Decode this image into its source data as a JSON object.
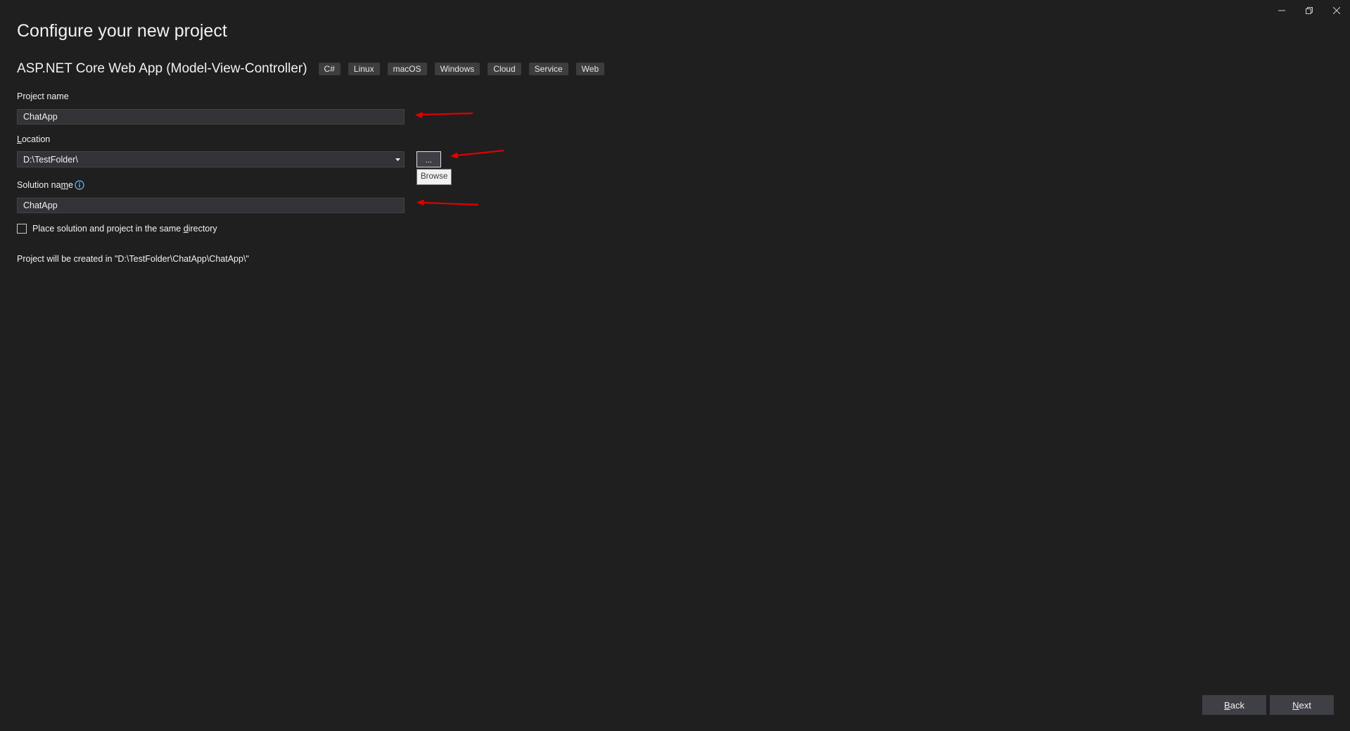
{
  "page": {
    "title": "Configure your new project"
  },
  "template": {
    "name": "ASP.NET Core Web App (Model-View-Controller)",
    "tags": [
      "C#",
      "Linux",
      "macOS",
      "Windows",
      "Cloud",
      "Service",
      "Web"
    ]
  },
  "project_name": {
    "label": "Project name",
    "value": "ChatApp"
  },
  "location": {
    "label_first": "L",
    "label_rest": "ocation",
    "value": "D:\\TestFolder\\",
    "browse_label": "...",
    "tooltip": "Browse"
  },
  "solution_name": {
    "label_before": "Solution na",
    "label_accel": "m",
    "label_after": "e",
    "value": "ChatApp"
  },
  "same_directory": {
    "label_before": "Place solution and project in the same ",
    "label_accel": "d",
    "label_after": "irectory",
    "checked": false
  },
  "create_path": {
    "text": "Project will be created in \"D:\\TestFolder\\ChatApp\\ChatApp\\\""
  },
  "footer": {
    "back_accel": "B",
    "back_rest": "ack",
    "next_accel": "N",
    "next_rest": "ext"
  },
  "colors": {
    "background": "#1f1f1f",
    "input_background": "#333337",
    "button_background": "#3f3f46",
    "tag_background": "#3d3d3d",
    "annotation_arrow": "#e00000",
    "info_icon": "#75beff"
  }
}
